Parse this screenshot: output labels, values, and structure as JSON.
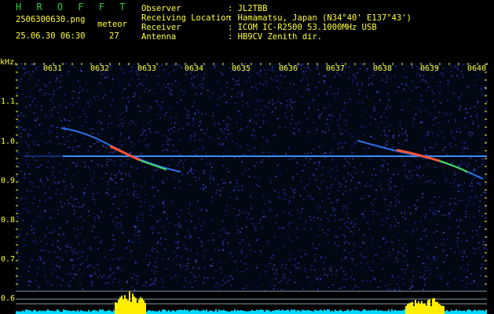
{
  "header": {
    "station": "H R O F F T",
    "filename": "2506300630.png",
    "datetime": "25.06.30 06:30",
    "meteor_label": "meteor",
    "meteor_count": "27",
    "observer_label": "Observer",
    "observer_value": ": JL2TBB",
    "location_label": "Receiving Location",
    "location_value": ": Hamamatsu, Japan (N34°40' E137°43')",
    "receiver_label": "Receiver",
    "receiver_value": ": ICOM IC-R2500 53.1000MHz USB",
    "antenna_label": "Antenna",
    "antenna_value": ": HB9CV Zenith dir."
  },
  "axis": {
    "unit": "kHz",
    "time_labels": [
      "0631",
      "0632",
      "0633",
      "0634",
      "0635",
      "0636",
      "0637",
      "0638",
      "0639",
      "0640"
    ],
    "freq_labels": [
      "1.1",
      "1.0",
      "0.9",
      "0.8",
      "0.7",
      "0.6"
    ]
  },
  "colors": {
    "background": "#000000",
    "text_yellow": "#ffff33",
    "text_green": "#2ecc40",
    "carrier": "#3a8cff",
    "noise": "#1a2a9a",
    "histogram_base": "#00d8ff",
    "histogram_peak": "#ffee00"
  }
}
